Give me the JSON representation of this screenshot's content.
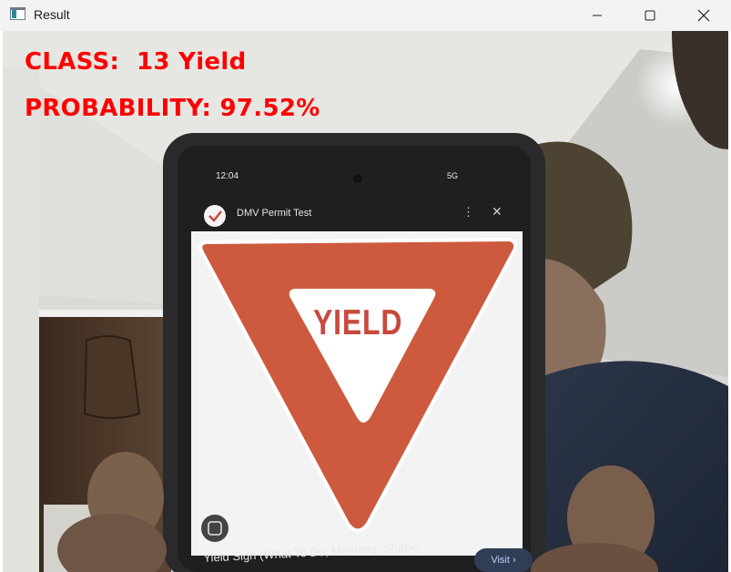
{
  "window": {
    "title": "Result",
    "icons": {
      "app": "opencv-window-icon",
      "minimize": "minimize-icon",
      "maximize": "maximize-icon",
      "close": "close-icon"
    }
  },
  "overlay": {
    "class_text": "CLASS:  13 Yield",
    "probability_text": "PROBABILITY: 97.52%",
    "color": "#ff0000"
  },
  "phone": {
    "status_time": "12:04",
    "status_right": "5G",
    "app_title": "DMV Permit Test",
    "kebab": "⋮",
    "close": "✕",
    "sign_text": "YIELD",
    "caption": "Yield Sign (What To Do, Meaning, Shape,",
    "visit_label": "Visit ›"
  },
  "colors": {
    "sign_red": "#cd5a3e",
    "phone_body": "#2a2a2c",
    "wall": "#d3d4d0"
  }
}
